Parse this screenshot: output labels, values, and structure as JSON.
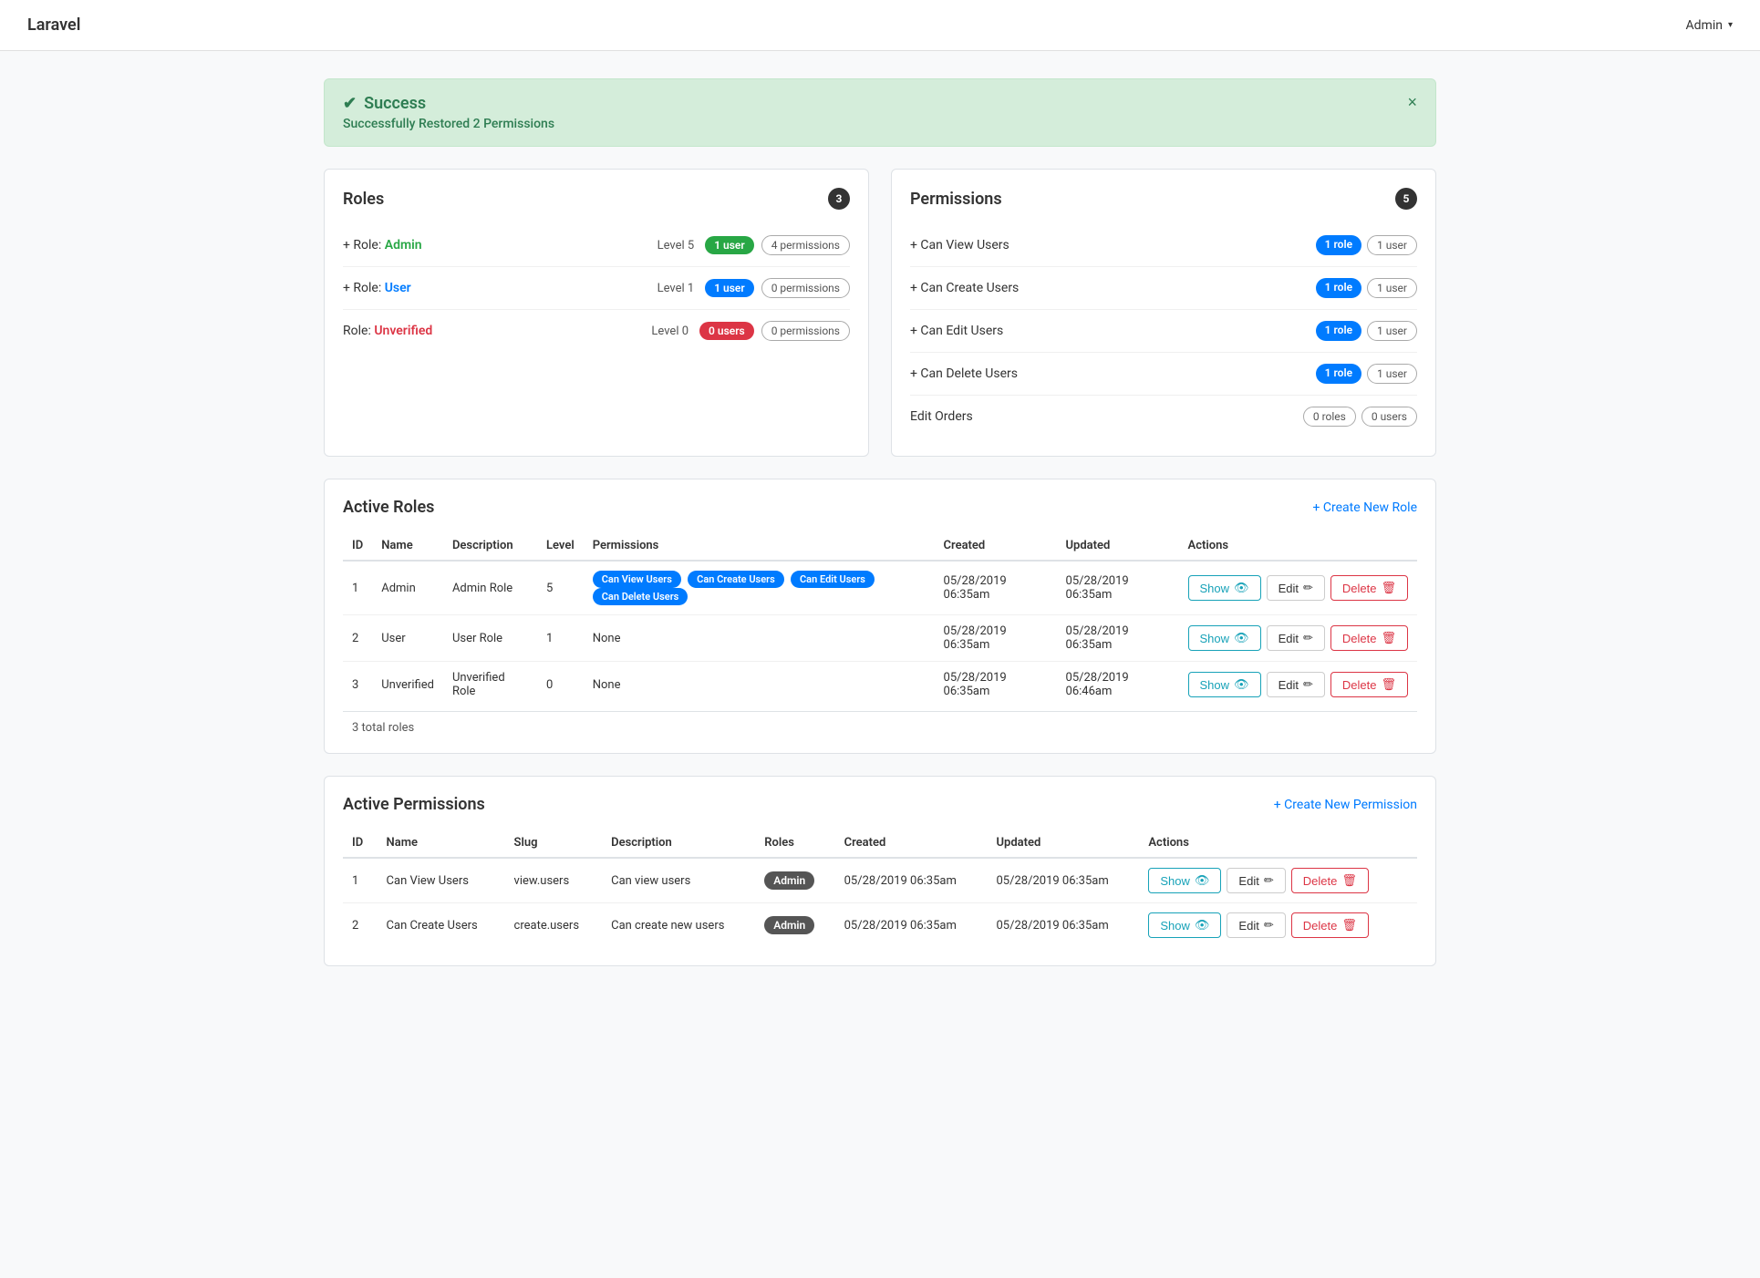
{
  "navbar": {
    "brand": "Laravel",
    "admin_label": "Admin",
    "admin_chevron": "▾"
  },
  "alert": {
    "icon": "✔",
    "title": "Success",
    "message": "Successfully Restored 2 Permissions",
    "close": "×"
  },
  "roles_card": {
    "title": "Roles",
    "count": "3",
    "items": [
      {
        "plus": "+",
        "label": "Role:",
        "name": "Admin",
        "name_type": "admin",
        "level_label": "Level 5",
        "badge1_text": "1 user",
        "badge1_type": "green",
        "badge2_text": "4 permissions",
        "badge2_type": "outline"
      },
      {
        "plus": "+",
        "label": "Role:",
        "name": "User",
        "name_type": "user",
        "level_label": "Level 1",
        "badge1_text": "1 user",
        "badge1_type": "blue",
        "badge2_text": "0 permissions",
        "badge2_type": "outline"
      },
      {
        "plus": "",
        "label": "Role:",
        "name": "Unverified",
        "name_type": "unverified",
        "level_label": "Level 0",
        "badge1_text": "0 users",
        "badge1_type": "red",
        "badge2_text": "0 permissions",
        "badge2_type": "outline"
      }
    ]
  },
  "permissions_card": {
    "title": "Permissions",
    "count": "5",
    "items": [
      {
        "plus": "+",
        "label": "Can View Users",
        "badge1_text": "1 role",
        "badge1_type": "blue",
        "badge2_text": "1 user",
        "badge2_type": "outline"
      },
      {
        "plus": "+",
        "label": "Can Create Users",
        "badge1_text": "1 role",
        "badge1_type": "blue",
        "badge2_text": "1 user",
        "badge2_type": "outline"
      },
      {
        "plus": "+",
        "label": "Can Edit Users",
        "badge1_text": "1 role",
        "badge1_type": "blue",
        "badge2_text": "1 user",
        "badge2_type": "outline"
      },
      {
        "plus": "+",
        "label": "Can Delete Users",
        "badge1_text": "1 role",
        "badge1_type": "blue",
        "badge2_text": "1 user",
        "badge2_type": "outline"
      },
      {
        "plus": "",
        "label": "Edit Orders",
        "badge1_text": "0 roles",
        "badge1_type": "outline",
        "badge2_text": "0 users",
        "badge2_type": "outline"
      }
    ]
  },
  "active_roles": {
    "title": "Active Roles",
    "create_link": "+ Create New Role",
    "columns": [
      "ID",
      "Name",
      "Description",
      "Level",
      "Permissions",
      "Created",
      "Updated",
      "Actions"
    ],
    "rows": [
      {
        "id": "1",
        "name": "Admin",
        "description": "Admin Role",
        "level": "5",
        "permissions": [
          "Can View Users",
          "Can Create Users",
          "Can Edit Users",
          "Can Delete Users"
        ],
        "created": "05/28/2019 06:35am",
        "updated": "05/28/2019 06:35am"
      },
      {
        "id": "2",
        "name": "User",
        "description": "User Role",
        "level": "1",
        "permissions": [],
        "permissions_label": "None",
        "created": "05/28/2019 06:35am",
        "updated": "05/28/2019 06:35am"
      },
      {
        "id": "3",
        "name": "Unverified",
        "description": "Unverified Role",
        "level": "0",
        "permissions": [],
        "permissions_label": "None",
        "created": "05/28/2019 06:35am",
        "updated": "05/28/2019 06:46am"
      }
    ],
    "footer": "3 total roles"
  },
  "active_permissions": {
    "title": "Active Permissions",
    "create_link": "+ Create New Permission",
    "columns": [
      "ID",
      "Name",
      "Slug",
      "Description",
      "Roles",
      "Created",
      "Updated",
      "Actions"
    ],
    "rows": [
      {
        "id": "1",
        "name": "Can View Users",
        "slug": "view.users",
        "description": "Can view users",
        "roles_tag": "Admin",
        "created": "05/28/2019 06:35am",
        "updated": "05/28/2019 06:35am"
      },
      {
        "id": "2",
        "name": "Can Create Users",
        "slug": "create.users",
        "description": "Can create new users",
        "roles_tag": "Admin",
        "created": "05/28/2019 06:35am",
        "updated": "05/28/2019 06:35am"
      }
    ]
  },
  "buttons": {
    "show": "Show",
    "edit": "Edit",
    "delete": "Delete",
    "show_icon": "👁",
    "edit_icon": "✏",
    "delete_icon": "🗑"
  }
}
